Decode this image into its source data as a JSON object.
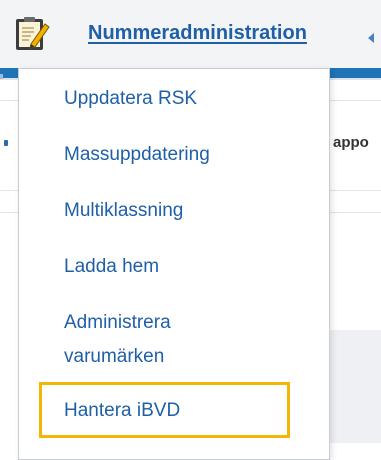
{
  "header": {
    "title": "Nummeradministration",
    "icon": "clipboard-edit-icon"
  },
  "background": {
    "partial_text": "appo"
  },
  "menu": {
    "items": [
      {
        "label": "Uppdatera RSK"
      },
      {
        "label": "Massuppdatering"
      },
      {
        "label": "Multiklassning"
      },
      {
        "label": "Ladda hem"
      },
      {
        "label": "Administrera varumärken"
      },
      {
        "label": "Hantera iBVD"
      }
    ]
  },
  "colors": {
    "link": "#1f5fa8",
    "accent_bar": "#1f73b7",
    "highlight": "#f2b705"
  }
}
